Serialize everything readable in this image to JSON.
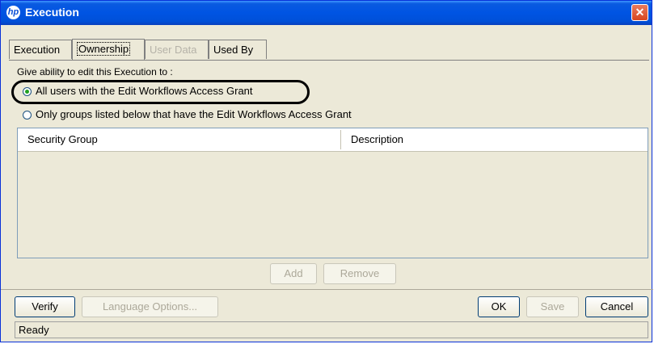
{
  "window": {
    "title": "Execution",
    "logo_text": "hp"
  },
  "tabs": [
    {
      "label": "Execution"
    },
    {
      "label": "Ownership"
    },
    {
      "label": "User Data"
    },
    {
      "label": "Used By"
    }
  ],
  "ownership": {
    "prompt": "Give ability to edit this Execution to :",
    "option_all": "All users with the Edit Workflows Access Grant",
    "option_groups": "Only groups listed below that have the Edit Workflows Access Grant",
    "selected": "option_all"
  },
  "table": {
    "columns": [
      "Security Group",
      "Description"
    ],
    "rows": []
  },
  "table_buttons": {
    "add": "Add",
    "remove": "Remove"
  },
  "footer_buttons": {
    "verify": "Verify",
    "language_options": "Language Options...",
    "ok": "OK",
    "save": "Save",
    "cancel": "Cancel"
  },
  "status": "Ready",
  "colors": {
    "titlebar": "#0054e3",
    "window_bg": "#ece9d8",
    "highlight_ring": "#000000",
    "radio_selected": "#21a121"
  },
  "icons": {
    "close": "close-icon",
    "logo": "hp-logo-icon"
  }
}
